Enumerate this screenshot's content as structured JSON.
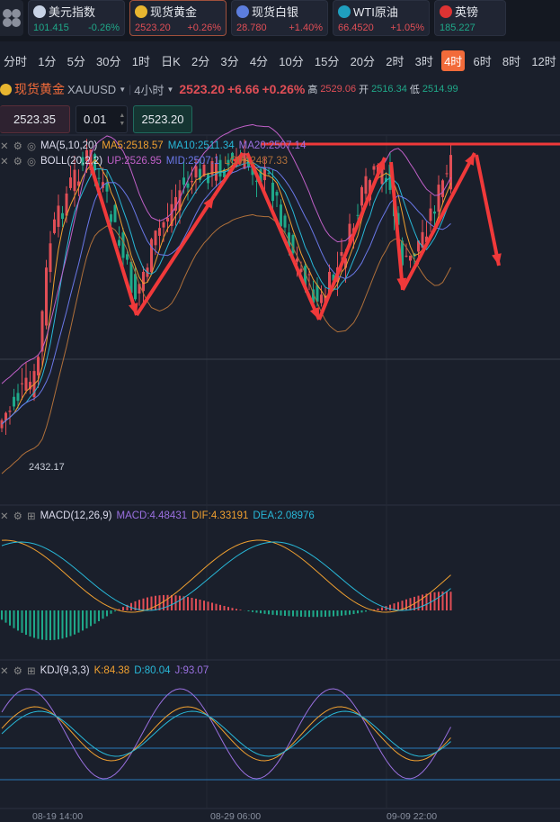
{
  "tickers": [
    {
      "name": "美元指数",
      "price": "101.415",
      "change": "-0.26%",
      "dir": "dn",
      "icon": "us-flag-icon",
      "color": "#c8d3e6"
    },
    {
      "name": "现货黄金",
      "price": "2523.20",
      "change": "+0.26%",
      "dir": "up",
      "icon": "gold-icon",
      "color": "#e8b630",
      "active": true
    },
    {
      "name": "现货白银",
      "price": "28.780",
      "change": "+1.40%",
      "dir": "up",
      "icon": "silver-icon",
      "color": "#5c7ddd"
    },
    {
      "name": "WTI原油",
      "price": "66.4520",
      "change": "+1.05%",
      "dir": "up",
      "icon": "oil-icon",
      "color": "#1f9fbf"
    },
    {
      "name": "英镑",
      "price": "185.227",
      "change": "",
      "dir": "dn",
      "icon": "uk-flag-icon",
      "color": "#d33"
    }
  ],
  "timeframes": [
    "分时",
    "1分",
    "5分",
    "30分",
    "1时",
    "日K",
    "2分",
    "3分",
    "4分",
    "10分",
    "15分",
    "20分",
    "2时",
    "3时",
    "4时",
    "6时",
    "8时",
    "12时"
  ],
  "selected_timeframe": "4时",
  "header": {
    "name": "现货黄金",
    "symbol": "XAUUSD",
    "period": "4小时",
    "price": "2523.20",
    "change": "+6.66",
    "pct": "+0.26%",
    "high_label": "高",
    "high": "2529.06",
    "open_label": "开",
    "open": "2516.34",
    "low_label": "低",
    "low": "2514.99"
  },
  "order": {
    "sell": "2523.35",
    "lot": "0.01",
    "buy": "2523.20"
  },
  "ma": {
    "title": "MA(5,10,20)",
    "ma5": "MA5:2518.57",
    "ma10": "MA10:2511.34",
    "ma20": "MA20:2507.14"
  },
  "boll": {
    "title": "BOLL(20,2,2)",
    "up": "UP:2526.95",
    "mid": "MID:2507.1",
    "low": "LOW:2487.33"
  },
  "low_marker": "2432.17",
  "macd": {
    "title": "MACD(12,26,9)",
    "macd": "MACD:4.48431",
    "dif": "DIF:4.33191",
    "dea": "DEA:2.08976"
  },
  "kdj": {
    "title": "KDJ(9,3,3)",
    "k": "K:84.38",
    "d": "D:80.04",
    "j": "J:93.07"
  },
  "time_axis": [
    "08-19 14:00",
    "08-29 06:00",
    "09-09 22:00"
  ],
  "colors": {
    "up": "#e04e56",
    "down": "#1fa889",
    "accent": "#f26b3a",
    "arrow": "#f0393a"
  }
}
